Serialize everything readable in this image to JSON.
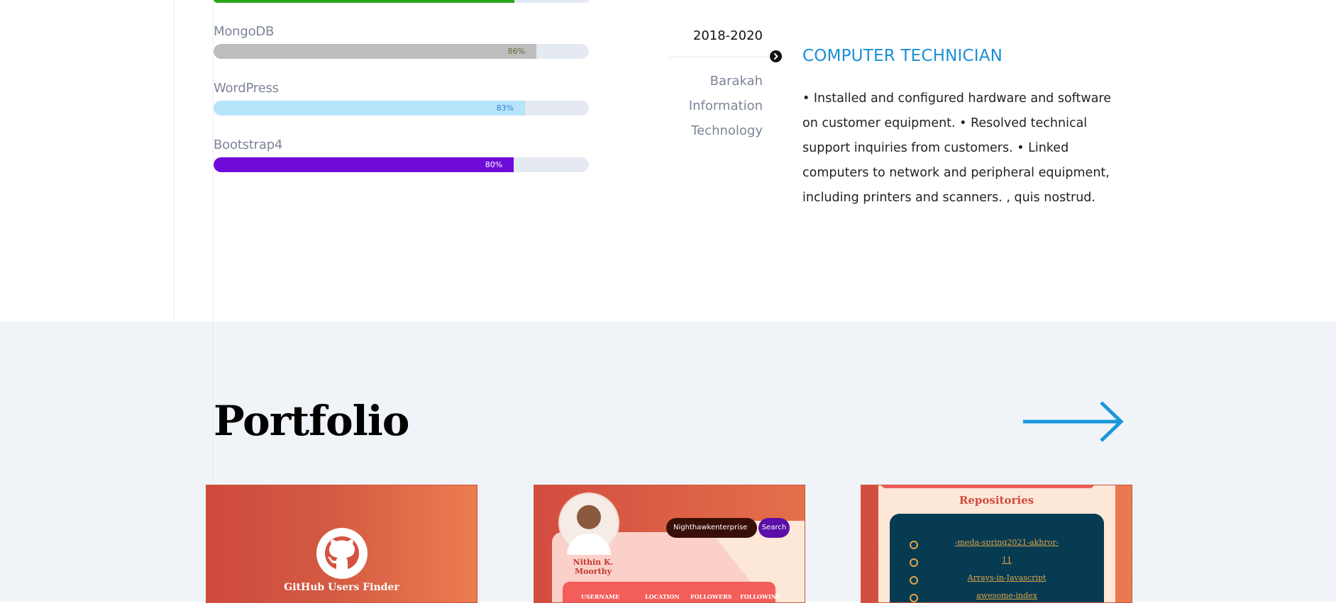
{
  "skills": {
    "top_bar": {
      "color": "#28a61a",
      "percent": 80
    },
    "items": [
      {
        "name": "MongoDB",
        "percent_label": "86%",
        "percent": 86,
        "color": "#bdbdbd",
        "label_color": "#5b6b3a"
      },
      {
        "name": "WordPress",
        "percent_label": "83%",
        "percent": 83,
        "color": "#b6e4fb",
        "label_color": "#2f7fc7"
      },
      {
        "name": "Bootstrap4",
        "percent_label": "80%",
        "percent": 80,
        "color": "#6f0bd8",
        "label_color": "#ffffff"
      }
    ]
  },
  "experience": {
    "years": "2018-2020",
    "company_lines": [
      "Barakah",
      "Information",
      "Technology"
    ],
    "title": "COMPUTER TECHNICIAN",
    "description": "• Installed and configured hardware and software on customer equipment. • Resolved technical support inquiries from customers. • Linked computers to network and peripheral equipment, including printers and scanners. , quis nostrud.",
    "marker_icon": "chevron-circle-right-icon"
  },
  "portfolio": {
    "title": "Portfolio",
    "arrow_icon": "arrow-right-icon",
    "cards": [
      {
        "caption": "GitHub Users Finder",
        "icon": "github-icon"
      },
      {
        "profile_name": "Nithin K. Moorthy",
        "search_value": "Nighthawkenterprise",
        "search_button": "Search",
        "columns": [
          "USERNAME",
          "LOCATION",
          "FOLLOWERS",
          "FOLLOWING"
        ]
      },
      {
        "heading": "Repositories",
        "repos": [
          "-meda-spring2021-akhror-",
          "11",
          "Arrays-in-Javascript",
          "awesome-index"
        ]
      }
    ]
  },
  "colors": {
    "accent": "#1a8fd6",
    "portfolio_bg": "#f0f3f7"
  }
}
